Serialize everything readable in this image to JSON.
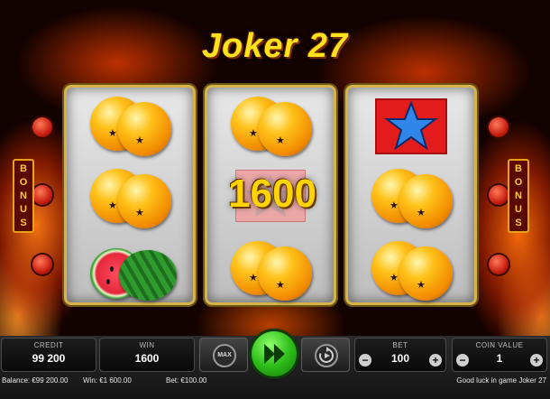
{
  "game": {
    "title": "Joker 27"
  },
  "bonus_label": [
    "B",
    "O",
    "N",
    "U",
    "S"
  ],
  "reels": [
    [
      "orange-pair",
      "orange-pair",
      "watermelon"
    ],
    [
      "orange-pair",
      "star-dimmed",
      "orange-pair"
    ],
    [
      "blue-star",
      "orange-pair",
      "orange-pair"
    ]
  ],
  "win_display": "1600",
  "panel": {
    "credit_label": "CREDIT",
    "credit_value": "99 200",
    "win_label": "WIN",
    "win_value": "1600",
    "max_label": "MAX",
    "bet_label": "BET",
    "bet_value": "100",
    "coin_label": "COIN VALUE",
    "coin_value": "1",
    "minus": "−",
    "plus": "+"
  },
  "status": {
    "balance": "Balance: €99 200.00",
    "win": "Win: €1 600.00",
    "bet": "Bet: €100.00",
    "message": "Good luck in game Joker 27"
  },
  "colors": {
    "title": "#ffe21a",
    "reel_frame": "#d6b24a",
    "spin_button": "#2fbf1a",
    "star_background": "#e41b1b",
    "star_blue": "#2f86e8",
    "win_text": "#ffd400"
  },
  "icons": {
    "spin": "double-play-arrow-icon",
    "autoplay": "circular-arrow-play-icon",
    "max_bet": "max-chip-icon"
  }
}
